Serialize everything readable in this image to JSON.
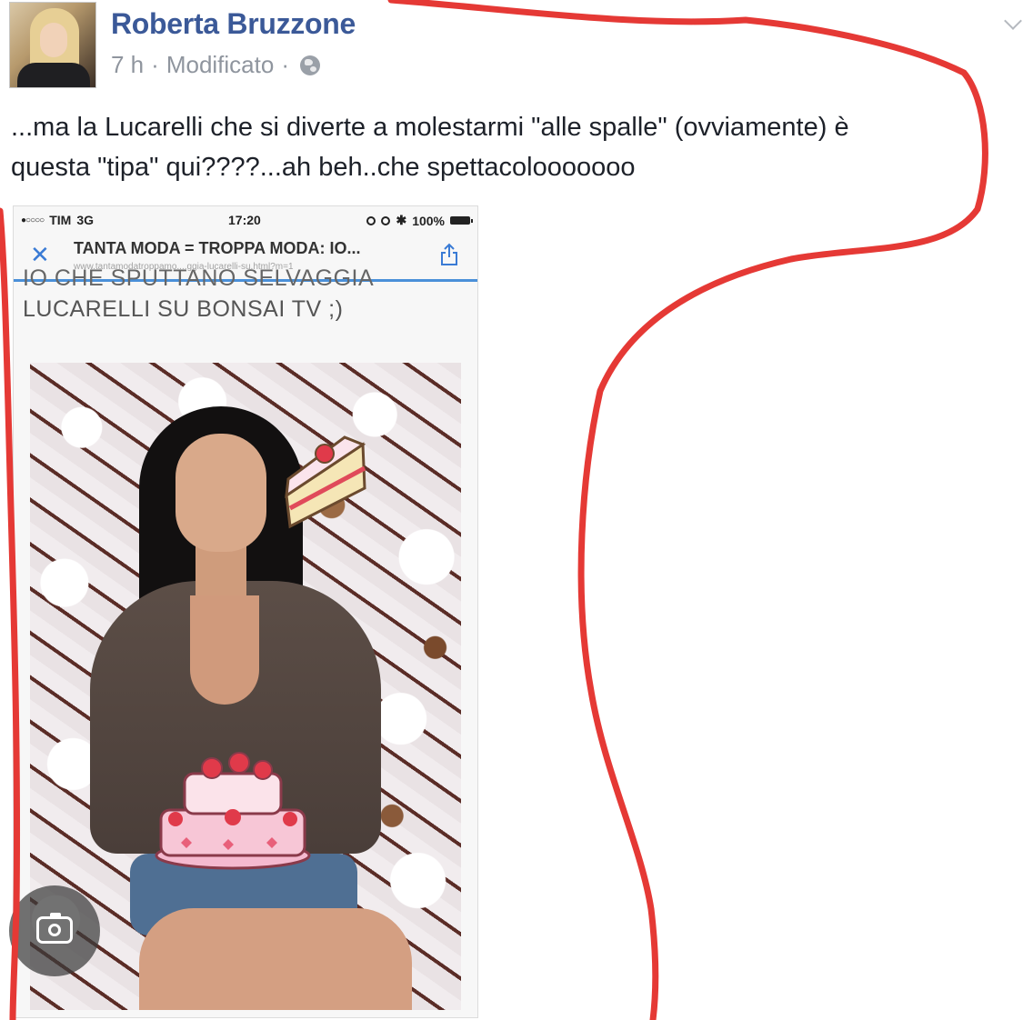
{
  "post": {
    "author": "Roberta Bruzzone",
    "time": "7 h",
    "separator": "·",
    "edited": "Modificato",
    "text_line1": "...ma la Lucarelli che si diverte a molestarmi \"alle spalle\" (ovviamente) è",
    "text_line2": "questa \"tipa\" qui????...ah beh..che spettacolooooooo"
  },
  "phone": {
    "status": {
      "carrier": "TIM",
      "network": "3G",
      "time": "17:20",
      "battery": "100%"
    },
    "browser": {
      "title": "TANTA MODA = TROPPA MODA: IO...",
      "url": "www.tantamodatroppamo....ggia-lucarelli-su.html?m=1"
    },
    "page": {
      "heading_line1": "IO CHE SPUTTANO SELVAGGIA",
      "heading_line2": "LUCARELLI SU BONSAI TV ;)"
    }
  },
  "icons": {
    "globe": "globe-icon",
    "close": "close-icon",
    "share": "share-icon",
    "chevron": "chevron-down-icon",
    "lens": "camera-search-icon"
  },
  "colors": {
    "author": "#3b5998",
    "meta": "#8f959e",
    "annotation": "#e53935",
    "browser_accent": "#4a90d9"
  }
}
